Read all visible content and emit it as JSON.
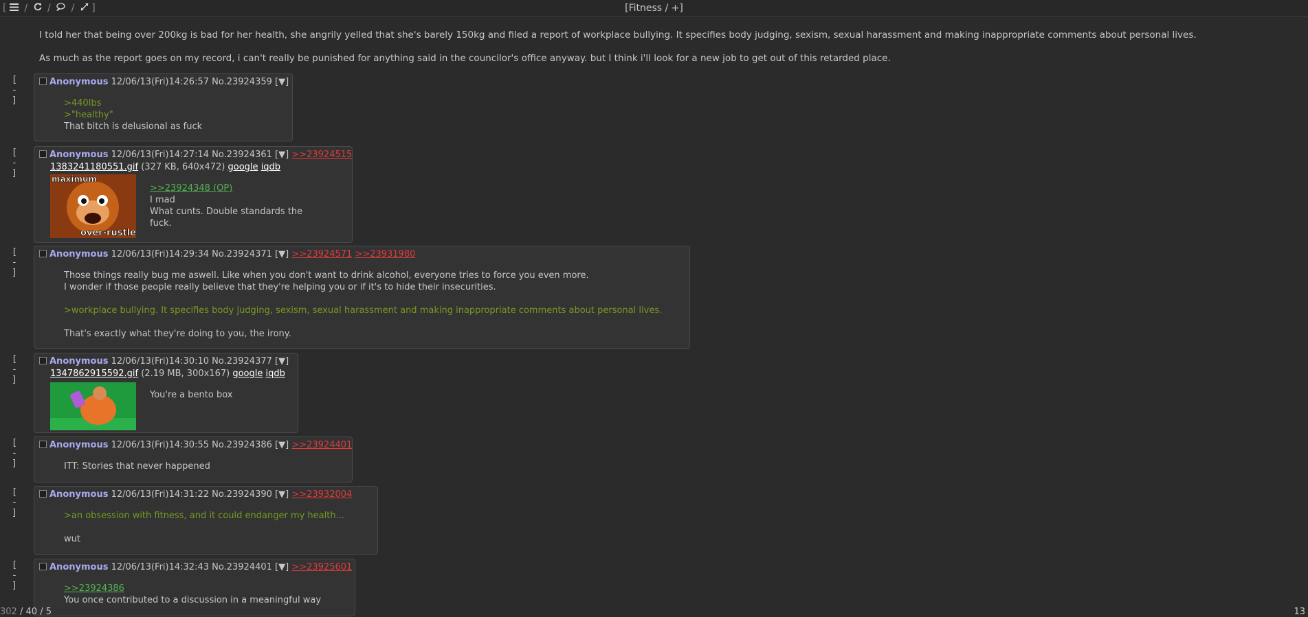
{
  "topbar": {
    "bracket_open": "[",
    "bracket_close": "]",
    "slash": "/",
    "icons": [
      "menu-icon",
      "refresh-icon",
      "speech-bubble-icon",
      "expand-icon"
    ],
    "title": "[Fitness / +]"
  },
  "op": {
    "paragraphs": [
      "I told her that being over 200kg is bad for her health, she angrily yelled that she's barely 150kg and filed a report of workplace bullying. It specifies body judging, sexism, sexual harassment and making inappropriate comments about personal lives.",
      "As much as the report goes on my record, i can't really be punished for anything said in the councilor's office anyway. but I think i'll look for a new job to get out of this retarded place."
    ]
  },
  "collapse_label": "[ - ]",
  "menu_label": "[▼]",
  "posts": [
    {
      "name": "Anonymous",
      "date": "12/06/13(Fri)14:26:57",
      "no": "No.23924359",
      "backlinks": [],
      "lines": [
        {
          "t": ">440lbs",
          "k": "gt"
        },
        {
          "t": ">\"healthy\"",
          "k": "gt"
        },
        {
          "t": "That bitch is delusional as fuck",
          "k": "n"
        }
      ]
    },
    {
      "name": "Anonymous",
      "date": "12/06/13(Fri)14:27:14",
      "no": "No.23924361",
      "backlinks": [
        ">>23924515"
      ],
      "file": {
        "filename": "1383241180551.gif",
        "meta": "(327 KB, 640x472)",
        "google": "google",
        "iqdb": "iqdb",
        "image_top_text": "maximum",
        "image_bottom_text": "over-rustle"
      },
      "lines": [
        {
          "t": ">>23924348 (OP)",
          "k": "ref"
        },
        {
          "t": "I mad",
          "k": "n"
        },
        {
          "t": "What cunts. Double standards the",
          "k": "n"
        },
        {
          "t": "fuck.",
          "k": "n"
        }
      ]
    },
    {
      "name": "Anonymous",
      "date": "12/06/13(Fri)14:29:34",
      "no": "No.23924371",
      "backlinks": [
        ">>23924571",
        ">>23931980"
      ],
      "lines": [
        {
          "t": "Those things really bug me aswell. Like when you don't want to drink alcohol, everyone tries to force you even more.",
          "k": "n"
        },
        {
          "t": "I wonder if those people really believe that they're helping you or if it's to hide their insecurities.",
          "k": "n"
        },
        {
          "t": "",
          "k": "n"
        },
        {
          "t": ">workplace bullying. It specifies body judging, sexism, sexual harassment and making inappropriate comments about personal lives.",
          "k": "gt"
        },
        {
          "t": "",
          "k": "n"
        },
        {
          "t": "That's exactly what they're doing to you, the irony.",
          "k": "n"
        }
      ]
    },
    {
      "name": "Anonymous",
      "date": "12/06/13(Fri)14:30:10",
      "no": "No.23924377",
      "backlinks": [],
      "file": {
        "filename": "1347862915592.gif",
        "meta": "(2.19 MB, 300x167)",
        "google": "google",
        "iqdb": "iqdb"
      },
      "lines": [
        {
          "t": "You're a bento box",
          "k": "n"
        }
      ]
    },
    {
      "name": "Anonymous",
      "date": "12/06/13(Fri)14:30:55",
      "no": "No.23924386",
      "backlinks": [
        ">>23924401"
      ],
      "lines": [
        {
          "t": "ITT: Stories that never happened",
          "k": "n"
        }
      ]
    },
    {
      "name": "Anonymous",
      "date": "12/06/13(Fri)14:31:22",
      "no": "No.23924390",
      "backlinks": [
        ">>23932004"
      ],
      "lines": [
        {
          "t": ">an obsession with fitness, and it could endanger my health...",
          "k": "gt"
        },
        {
          "t": "",
          "k": "n"
        },
        {
          "t": "wut",
          "k": "n"
        }
      ]
    },
    {
      "name": "Anonymous",
      "date": "12/06/13(Fri)14:32:43",
      "no": "No.23924401",
      "backlinks": [
        ">>23925601"
      ],
      "lines": [
        {
          "t": ">>23924386",
          "k": "ref"
        },
        {
          "t": "You once contributed to a discussion in a meaningful way",
          "k": "n"
        }
      ]
    }
  ],
  "status": {
    "posts": "302",
    "slash": "/",
    "images": "40",
    "slash2": "/",
    "pages": "5",
    "right": "13"
  },
  "colors": {
    "background": "#2b2b2b",
    "post_bg": "#333333",
    "name": "#a9a9f0",
    "greentext": "#789922",
    "quotelink": "#e03b3b",
    "reflink": "#52b452"
  }
}
